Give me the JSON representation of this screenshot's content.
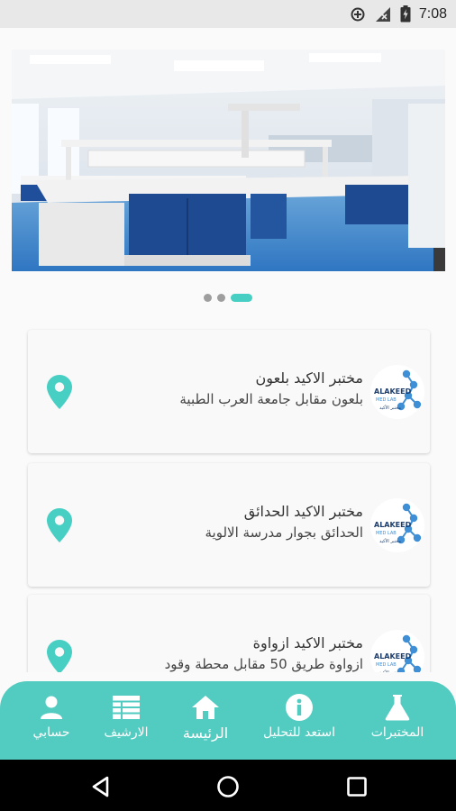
{
  "status_bar": {
    "time": "7:08",
    "icons": [
      "data-saver-icon",
      "signal-icon",
      "battery-icon"
    ]
  },
  "carousel": {
    "image": "laboratory-benches-photo",
    "page_count": 3,
    "active_index": 2
  },
  "labs": [
    {
      "name": "مختبر الاكيد بلعون",
      "address": "بلعون مقابل جامعة العرب الطبية"
    },
    {
      "name": "مختبر الاكيد الحدائق",
      "address": "الحدائق بجوار مدرسة الالوية"
    },
    {
      "name": "مختبر الاكيد ازواوة",
      "address": "ازواوة طريق 50 مقابل محطة وقود"
    }
  ],
  "logo": {
    "title": "ALAKEED",
    "subtitle": "MED LAB",
    "tagline": "مختبر الأكيد"
  },
  "bottom_nav": {
    "items": [
      {
        "label": "حسابي",
        "icon": "person-icon"
      },
      {
        "label": "الارشيف",
        "icon": "archive-grid-icon"
      },
      {
        "label": "الرئيسة",
        "icon": "home-icon"
      },
      {
        "label": "استعد للتحليل",
        "icon": "info-icon"
      },
      {
        "label": "المختبرات",
        "icon": "flask-icon"
      }
    ],
    "active": "الرئيسة"
  },
  "colors": {
    "accent": "#52cbc0",
    "pin": "#47cfc3",
    "logo_blue": "#3f8fd6"
  }
}
